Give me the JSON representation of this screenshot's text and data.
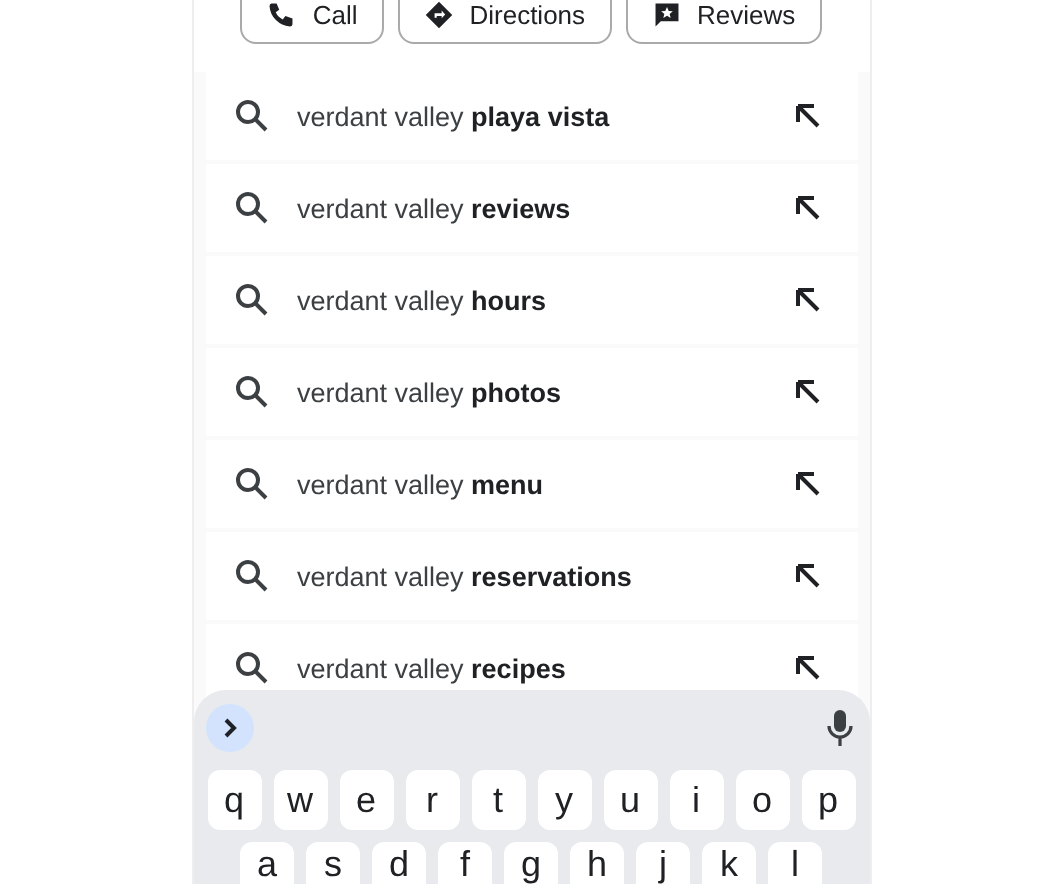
{
  "actions": [
    {
      "kind": "call",
      "label": "Call"
    },
    {
      "kind": "directions",
      "label": "Directions"
    },
    {
      "kind": "reviews",
      "label": "Reviews"
    }
  ],
  "suggestions": [
    {
      "text": "verdant valley **playa vista**"
    },
    {
      "text": "verdant valley **reviews**"
    },
    {
      "text": "verdant valley **hours**"
    },
    {
      "text": "verdant valley **photos**"
    },
    {
      "text": "verdant valley **menu**"
    },
    {
      "text": "verdant valley **reservations**"
    },
    {
      "text": "verdant valley **recipes**"
    }
  ],
  "keyboard": {
    "rows": [
      [
        "q",
        "w",
        "e",
        "r",
        "t",
        "y",
        "u",
        "i",
        "o",
        "p"
      ],
      [
        "a",
        "s",
        "d",
        "f",
        "g",
        "h",
        "j",
        "k",
        "l"
      ]
    ]
  }
}
